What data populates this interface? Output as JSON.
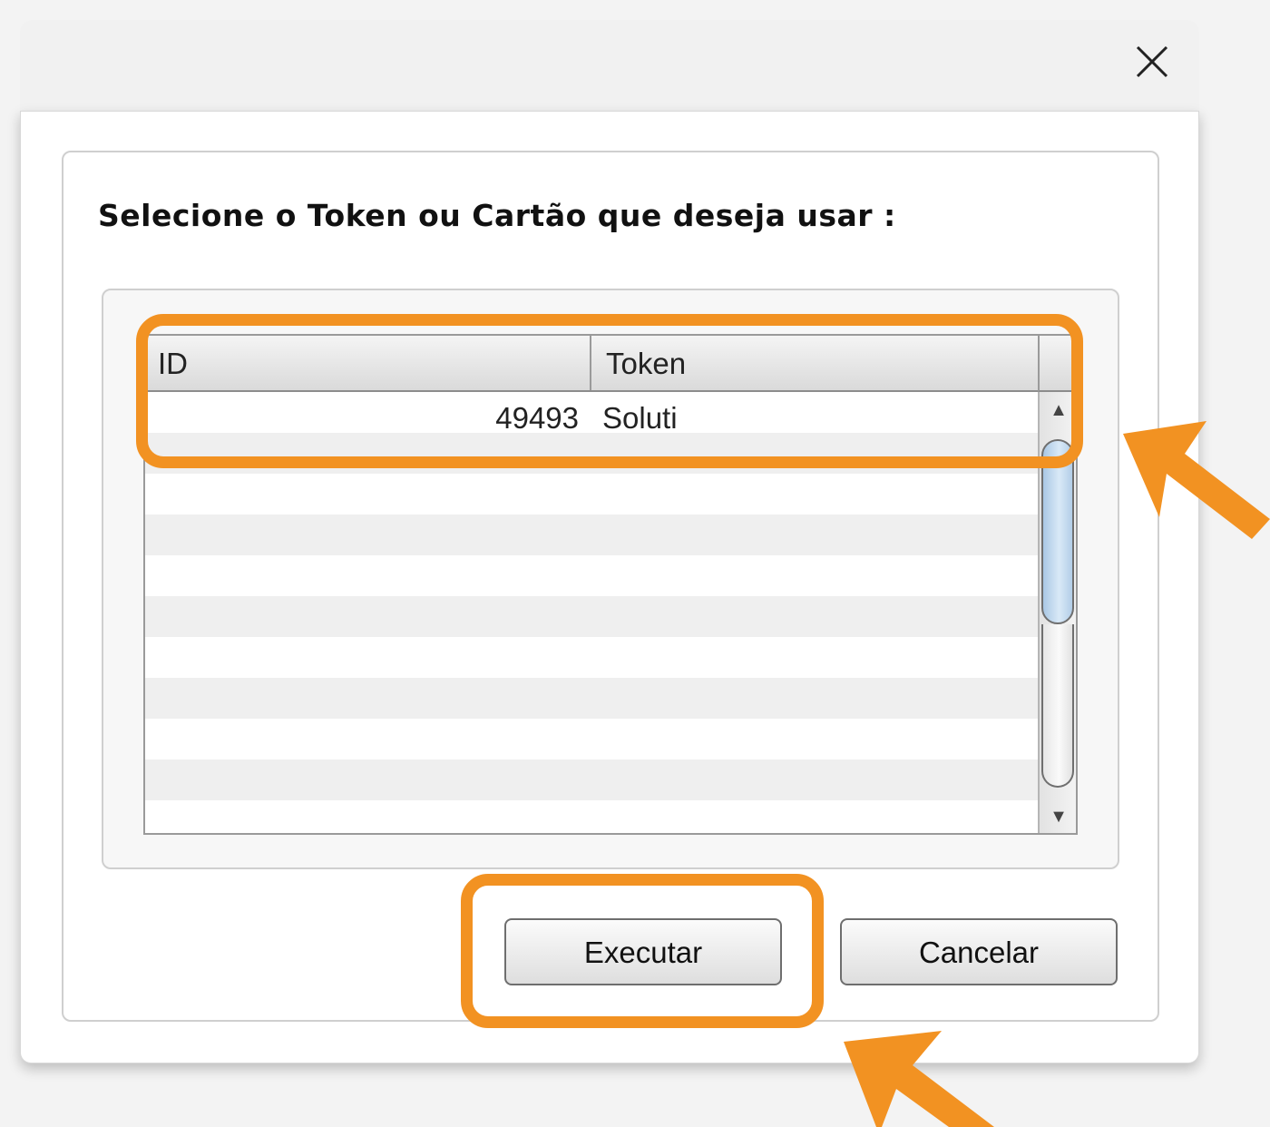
{
  "dialog": {
    "prompt": "Selecione o Token ou Cartão que deseja usar :",
    "close_icon": "close-icon"
  },
  "table": {
    "columns": [
      "ID",
      "Token"
    ],
    "rows": [
      {
        "id": "49493",
        "token": "Soluti"
      }
    ]
  },
  "buttons": {
    "execute": "Executar",
    "cancel": "Cancelar"
  },
  "highlight": {
    "color": "#f29222"
  }
}
